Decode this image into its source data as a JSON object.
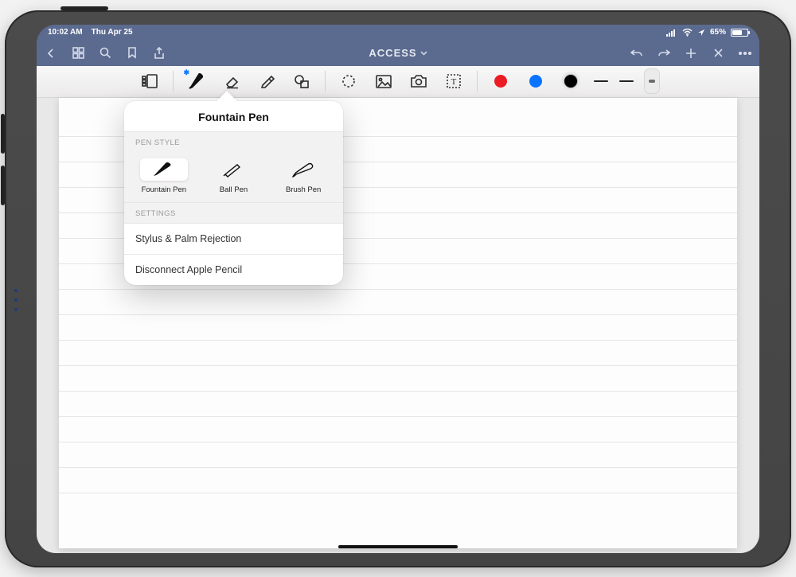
{
  "status": {
    "time": "10:02 AM",
    "date": "Thu Apr 25",
    "battery": "65%"
  },
  "nav": {
    "title": "ACCESS"
  },
  "toolbar": {
    "colors": {
      "red": "#ec1c24",
      "blue": "#0b74ff",
      "black": "#000000"
    }
  },
  "popover": {
    "title": "Fountain Pen",
    "section_pen": "PEN STYLE",
    "pens": {
      "fountain": "Fountain Pen",
      "ball": "Ball Pen",
      "brush": "Brush Pen"
    },
    "section_settings": "SETTINGS",
    "row_stylus": "Stylus & Palm Rejection",
    "row_disconnect": "Disconnect Apple Pencil"
  }
}
